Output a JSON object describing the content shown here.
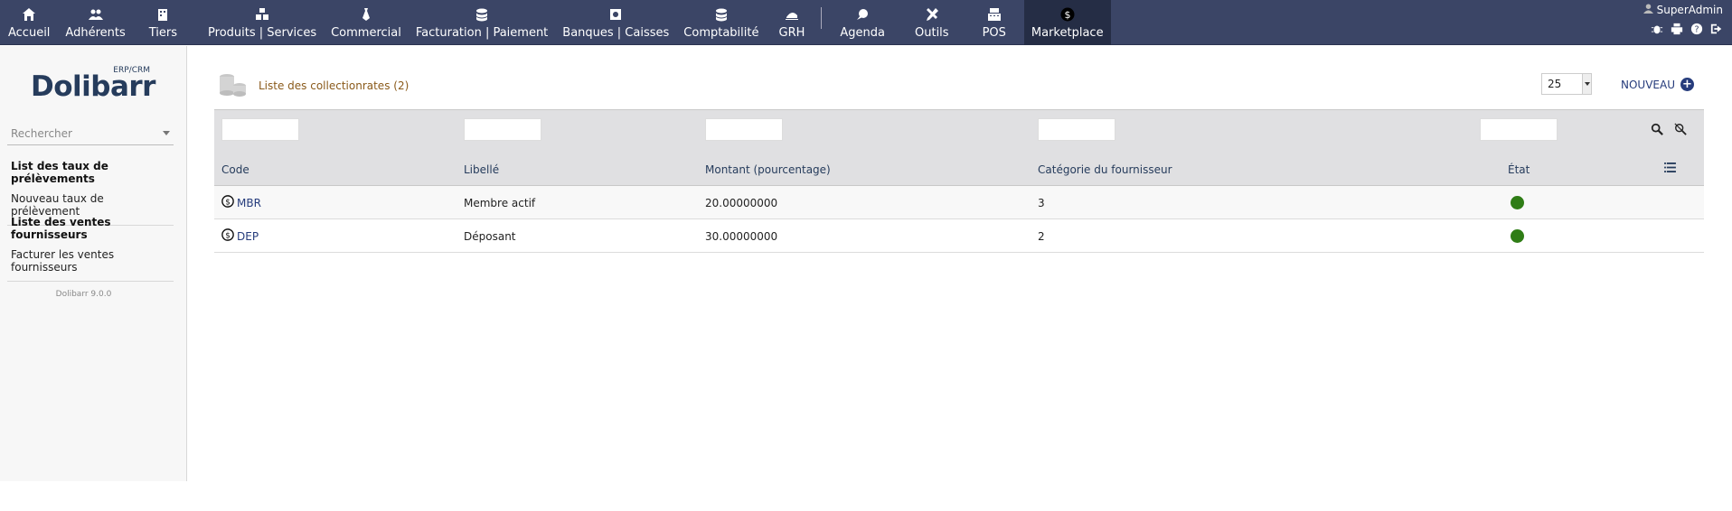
{
  "menu": {
    "items": [
      {
        "label": "Accueil",
        "icon": "home-icon"
      },
      {
        "label": "Adhérents",
        "icon": "members-icon"
      },
      {
        "label": "Tiers",
        "icon": "building-icon"
      },
      {
        "label": "Produits | Services",
        "icon": "cubes-icon"
      },
      {
        "label": "Commercial",
        "icon": "tie-icon"
      },
      {
        "label": "Facturation | Paiement",
        "icon": "coins-icon"
      },
      {
        "label": "Banques | Caisses",
        "icon": "bank-icon"
      },
      {
        "label": "Comptabilité",
        "icon": "ledger-icon"
      },
      {
        "label": "GRH",
        "icon": "hr-icon"
      },
      {
        "label": "Agenda",
        "icon": "agenda-icon"
      },
      {
        "label": "Outils",
        "icon": "tools-icon"
      },
      {
        "label": "POS",
        "icon": "cash-register-icon"
      },
      {
        "label": "Marketplace",
        "icon": "marketplace-icon"
      }
    ],
    "active": "Marketplace"
  },
  "user": {
    "name": "SuperAdmin"
  },
  "sidebar": {
    "logo_name": "Dolibarr",
    "logo_tag": "ERP/CRM",
    "search_placeholder": "Rechercher",
    "block1_title": "List des taux de prélèvements",
    "block1_link": "Nouveau taux de prélèvement",
    "block2_title": "Liste des ventes fournisseurs",
    "block2_link": "Facturer les ventes fournisseurs",
    "version": "Dolibarr 9.0.0"
  },
  "page": {
    "title": "Liste des collectionrates (2)",
    "limit": "25",
    "new_label": "NOUVEAU"
  },
  "table": {
    "headers": {
      "code": "Code",
      "libelle": "Libellé",
      "montant": "Montant (pourcentage)",
      "categorie": "Catégorie du fournisseur",
      "etat": "État"
    },
    "rows": [
      {
        "code": "MBR",
        "libelle": "Membre actif",
        "montant": "20.00000000",
        "categorie": "3",
        "etat": "active"
      },
      {
        "code": "DEP",
        "libelle": "Déposant",
        "montant": "30.00000000",
        "categorie": "2",
        "etat": "active"
      }
    ]
  },
  "colors": {
    "topbar": "#3b4566",
    "active_menu": "#252d45",
    "link": "#263c7c",
    "title": "#8a5a1a",
    "status_ok": "#2f7d16"
  }
}
